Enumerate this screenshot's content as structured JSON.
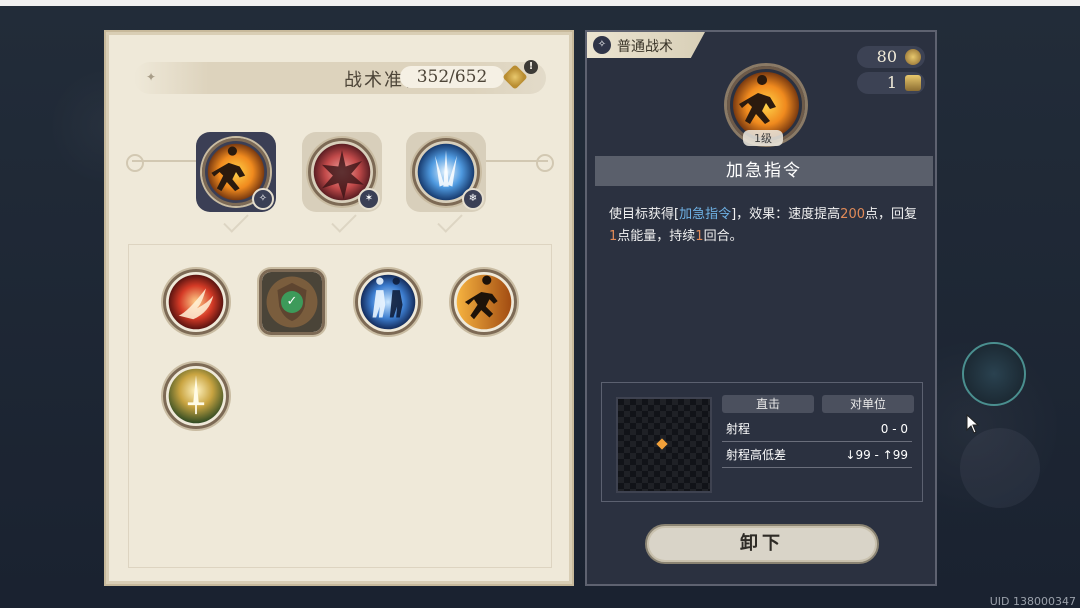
{
  "left_panel": {
    "title": "战术准备",
    "count": "352/652",
    "alert_label": "!"
  },
  "equipped_slots": [
    {
      "icon": "runner-icon",
      "badge": "✧"
    },
    {
      "icon": "shatter-icon",
      "badge": "✶"
    },
    {
      "icon": "ice-burst-icon",
      "badge": "❄"
    }
  ],
  "skill_pool": [
    {
      "icon": "flame-burst-icon",
      "equipped": false
    },
    {
      "icon": "shield-emblem-icon",
      "equipped": true
    },
    {
      "icon": "twin-figures-icon",
      "equipped": false
    },
    {
      "icon": "sprinting-figure-icon",
      "equipped": false
    },
    {
      "icon": "holy-sword-icon",
      "equipped": false
    }
  ],
  "check_glyph": "✓",
  "right_panel": {
    "tag": "普通战术",
    "tag_icon": "✧",
    "resource_1": "80",
    "resource_2": "1",
    "level": "1级",
    "skill_name": "加急指令",
    "desc": {
      "p1": "使目标获得[",
      "link": "加急指令",
      "p2": "]，效果：速度提高",
      "num1": "200",
      "p3": "点，回复",
      "num2": "1",
      "p4": "点能量，持续",
      "num3": "1",
      "p5": "回合。"
    },
    "range": {
      "chip_1": "直击",
      "chip_2": "对单位",
      "rows": [
        {
          "label": "射程",
          "value": "0 - 0"
        },
        {
          "label": "射程高低差",
          "value": "↓99 - ↑99"
        }
      ]
    },
    "unload_button": "卸下"
  },
  "footer": {
    "uid": "UID 138000347 "
  },
  "colors": {
    "accent_orange": "#e08a58",
    "accent_blue": "#6fb2e6",
    "equipped_green": "#3d9a5a"
  }
}
